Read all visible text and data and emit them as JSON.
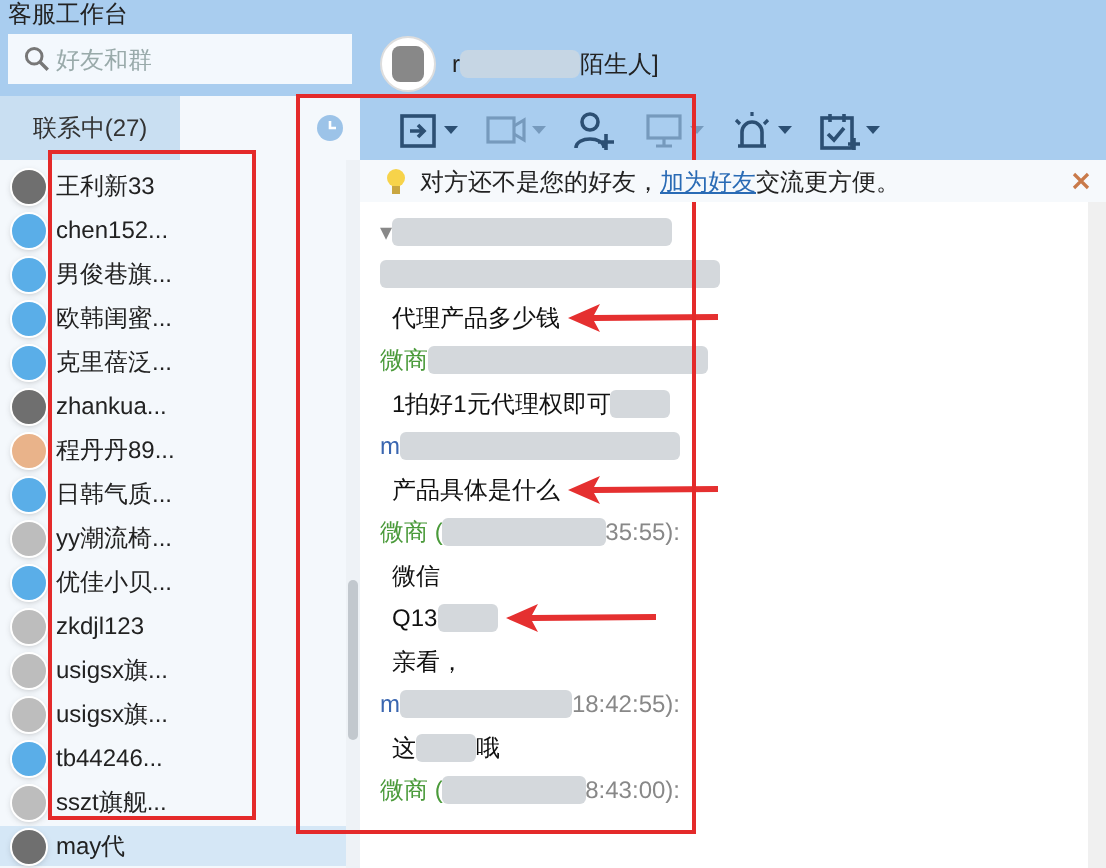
{
  "window": {
    "title": "客服工作台"
  },
  "search": {
    "placeholder": "好友和群"
  },
  "tabs": [
    {
      "label": "联系中(27)",
      "selected": false
    },
    {
      "kind": "recent",
      "selected": true
    }
  ],
  "contacts": [
    {
      "name": "王利新33",
      "kind": "photo",
      "selected": false
    },
    {
      "name": "chen152...",
      "kind": "blue",
      "selected": false
    },
    {
      "name": "男俊巷旗...",
      "kind": "blue",
      "selected": false
    },
    {
      "name": "欧韩闺蜜...",
      "kind": "blue",
      "selected": false
    },
    {
      "name": "克里蓓泛...",
      "kind": "blue",
      "selected": false
    },
    {
      "name": "zhankua...",
      "kind": "photo",
      "selected": false
    },
    {
      "name": "程丹丹89...",
      "kind": "cartoon",
      "selected": false
    },
    {
      "name": "日韩气质...",
      "kind": "blue",
      "selected": false
    },
    {
      "name": "yy潮流椅...",
      "kind": "grey",
      "selected": false
    },
    {
      "name": "优佳小贝...",
      "kind": "blue",
      "selected": false
    },
    {
      "name": "zkdjl123",
      "kind": "grey",
      "selected": false
    },
    {
      "name": "usigsx旗...",
      "kind": "grey",
      "selected": false
    },
    {
      "name": "usigsx旗...",
      "kind": "grey",
      "selected": false
    },
    {
      "name": "tb44246...",
      "kind": "blue",
      "selected": false
    },
    {
      "name": "sszt旗舰...",
      "kind": "grey",
      "selected": false
    },
    {
      "name": "may代",
      "kind": "photo",
      "selected": true
    }
  ],
  "chat_header": {
    "name_start": "r",
    "name_end": "陌生人]"
  },
  "toolbar": [
    {
      "kind": "file",
      "disabled": false
    },
    {
      "kind": "video",
      "disabled": true
    },
    {
      "kind": "add-person",
      "disabled": false
    },
    {
      "kind": "screen",
      "disabled": true
    },
    {
      "kind": "alarm",
      "disabled": false
    },
    {
      "kind": "calendar",
      "disabled": false
    }
  ],
  "notice": {
    "text": "对方还不是您的好友，",
    "link": "加为好友",
    "text_after": "交流更方便。"
  },
  "messages": [
    {
      "kind": "sender",
      "name": "▾",
      "color": "#888888"
    },
    {
      "kind": "blur"
    },
    {
      "kind": "text",
      "parts": [
        "代理产品多少钱"
      ],
      "marked": true
    },
    {
      "kind": "sender",
      "name": "微商",
      "color": "#4a9a3a"
    },
    {
      "kind": "text",
      "parts": [
        "1拍好1元代理权即可"
      ],
      "blur_end": true,
      "marked": false
    },
    {
      "kind": "sender",
      "name": "m",
      "color": "#3a66b0"
    },
    {
      "kind": "text",
      "parts": [
        "产品具体是什么"
      ],
      "marked": true
    },
    {
      "kind": "sender",
      "name": "微商 (",
      "time": "35:55):",
      "color": "#4a9a3a"
    },
    {
      "kind": "text",
      "parts": [
        "微信"
      ],
      "marked": false
    },
    {
      "kind": "text",
      "parts": [
        "Q13"
      ],
      "blur_end": true,
      "marked": true
    },
    {
      "kind": "text",
      "parts": [
        "亲看，"
      ],
      "marked": false
    },
    {
      "kind": "sender",
      "name": "m",
      "time": "18:42:55):",
      "color": "#3a66b0"
    },
    {
      "kind": "text",
      "parts": [
        "这",
        "哦"
      ],
      "marked": false
    },
    {
      "kind": "sender",
      "name": "微商 (",
      "time": "8:43:00):",
      "color": "#4a9a3a"
    }
  ],
  "annotation": {
    "contacts_boxed": true,
    "chat_boxed": true
  }
}
